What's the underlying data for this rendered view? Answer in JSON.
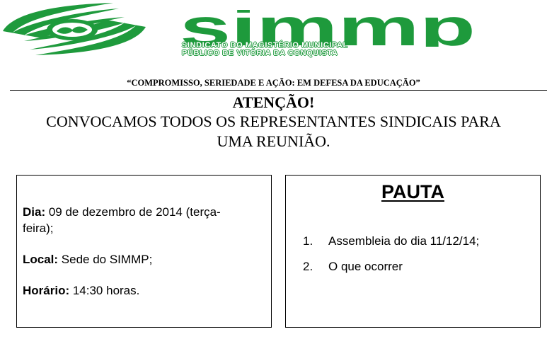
{
  "logo": {
    "wordmark": "simmp",
    "subname_line1": "SINDICATO DO MAGISTÉRIO MUNICIPAL",
    "subname_line2": "PÚBLICO DE VITÓRIA DA CONQUISTA",
    "brand_color": "#1e9a3c",
    "emblem_icon": "swoosh-handshake-icon"
  },
  "motto": "“COMPROMISSO, SERIEDADE E AÇÃO: EM DEFESA DA EDUCAÇÃO”",
  "heading": "ATENÇÃO!",
  "notice_line1": "CONVOCAMOS TODOS OS REPRESENTANTES SINDICAIS PARA",
  "notice_line2": "UMA REUNIÃO.",
  "details": {
    "day_label": "Dia:",
    "day_value_line1": " 09 de dezembro de 2014 (terça-",
    "day_value_line2": "feira);",
    "place_label": "Local:",
    "place_value": " Sede do SIMMP;",
    "time_label": "Horário:",
    "time_value": " 14:30 horas."
  },
  "agenda": {
    "title": "PAUTA",
    "items": [
      {
        "num": "1.",
        "text": "Assembleia do dia 11/12/14;"
      },
      {
        "num": "2.",
        "text": "O que ocorrer"
      }
    ]
  }
}
